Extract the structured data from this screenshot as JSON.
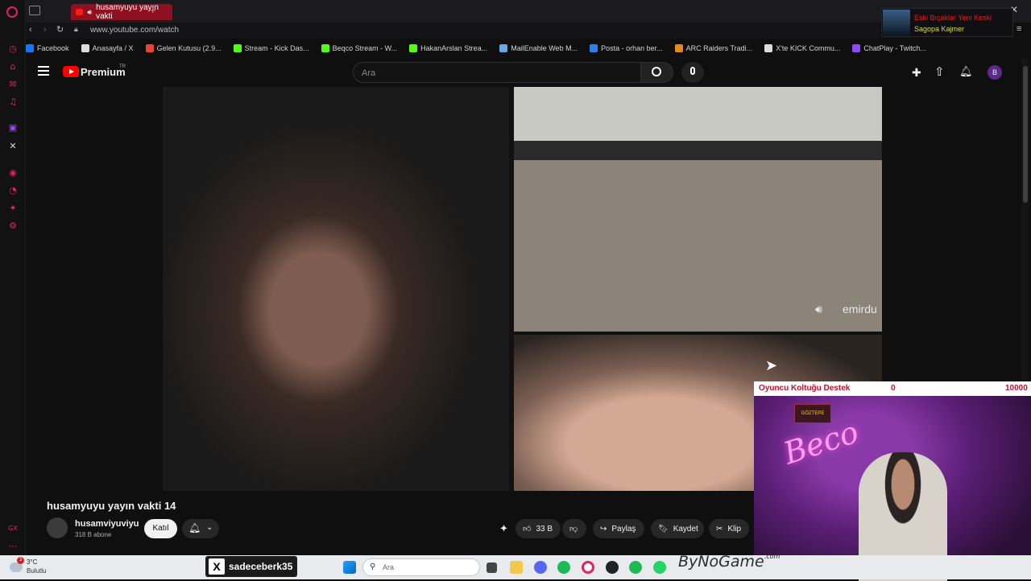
{
  "browser": {
    "tab_title": "husamyuyu yayın vakti",
    "url": "www.youtube.com/watch",
    "bookmarks": [
      {
        "label": "Facebook",
        "color": "#1877f2"
      },
      {
        "label": "Anasayfa / X",
        "color": "#dddddd"
      },
      {
        "label": "Gelen Kutusu (2.9...",
        "color": "#ea4335"
      },
      {
        "label": "Stream - Kick Das...",
        "color": "#53fc18"
      },
      {
        "label": "Beqco Stream - W...",
        "color": "#53fc18"
      },
      {
        "label": "HakanArslan Strea...",
        "color": "#53fc18"
      },
      {
        "label": "MailEnable Web M...",
        "color": "#6aa6e8"
      },
      {
        "label": "Posta - orhan ber...",
        "color": "#2f80ed"
      },
      {
        "label": "ARC Raiders Tradi...",
        "color": "#e58a1f"
      },
      {
        "label": "X'te KICK Commu...",
        "color": "#dddddd"
      },
      {
        "label": "ChatPlay - Twitch...",
        "color": "#9146ff"
      }
    ]
  },
  "promo": {
    "title": "Eski Bıçaklar Yeni Keski",
    "subtitle": "Sagopa Kajmer"
  },
  "youtube": {
    "logo_label": "Premium",
    "region": "TR",
    "search_placeholder": "Ara",
    "video_overlay_text": "emirdu",
    "video_title": "husamyuyu yayın vakti 14",
    "channel": {
      "name": "husamviyuviyu",
      "subscribers": "318 B abone",
      "join_label": "Katıl"
    },
    "actions": {
      "likes": "33 B",
      "share": "Paylaş",
      "save": "Kaydet",
      "clip": "Klip"
    }
  },
  "stream_overlay": {
    "goal_label": "Oyuncu Koltuğu Destek",
    "goal_current": "0",
    "goal_target": "10000",
    "neon_text": "Beco",
    "sign_text": "GÖZTEPE"
  },
  "stream_tag": {
    "x_handle": "sadeceberk35",
    "sponsor": "ByNoGame",
    "sponsor_suffix": ".com"
  },
  "taskbar": {
    "temperature": "3°C",
    "weather": "Bulutlu",
    "notification_count": "3",
    "search_placeholder": "Ara"
  }
}
